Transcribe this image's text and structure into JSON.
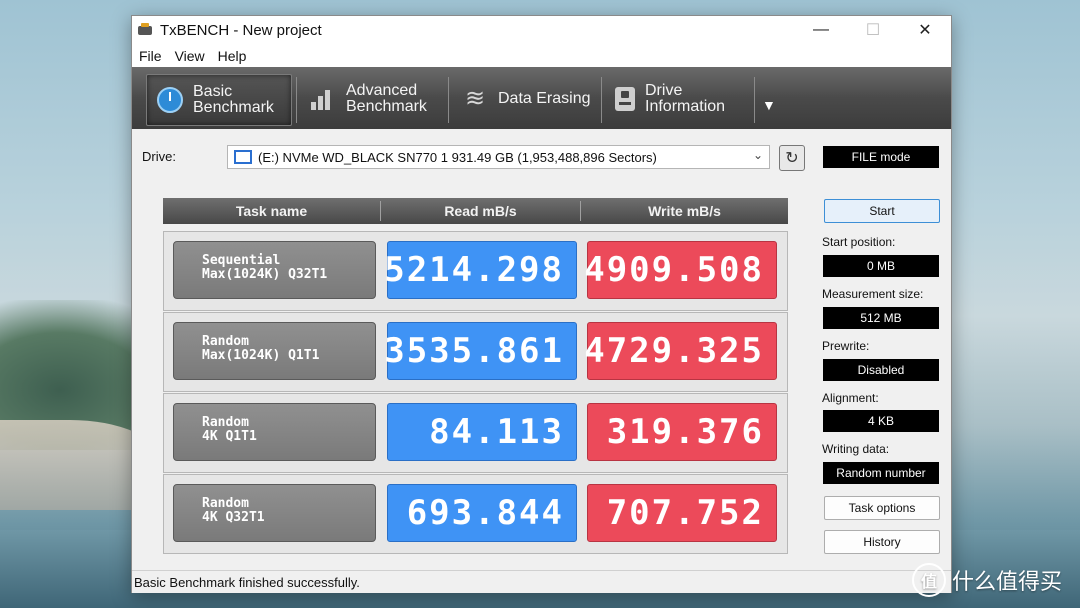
{
  "window": {
    "title": "TxBENCH - New project"
  },
  "window_controls": {
    "minimize": "—",
    "maximize": "☐",
    "close": "✕"
  },
  "menu": [
    "File",
    "View",
    "Help"
  ],
  "toolbar": {
    "tabs": [
      {
        "line1": "Basic",
        "line2": "Benchmark"
      },
      {
        "line1": "Advanced",
        "line2": "Benchmark"
      },
      {
        "line1": "Data Erasing",
        "line2": ""
      },
      {
        "line1": "Drive",
        "line2": "Information"
      }
    ],
    "more": "▼"
  },
  "drive": {
    "label": "Drive:",
    "value": "(E:) NVMe WD_BLACK SN770 1  931.49 GB (1,953,488,896 Sectors)",
    "mode": "FILE mode"
  },
  "grid": {
    "headers": {
      "task": "Task name",
      "read": "Read mB/s",
      "write": "Write mB/s"
    },
    "rows": [
      {
        "line1": "Sequential",
        "line2": "Max(1024K) Q32T1",
        "read": "5214.298",
        "write": "4909.508"
      },
      {
        "line1": "Random",
        "line2": "Max(1024K) Q1T1",
        "read": "3535.861",
        "write": "4729.325"
      },
      {
        "line1": "Random",
        "line2": "4K Q1T1",
        "read": "84.113",
        "write": "319.376"
      },
      {
        "line1": "Random",
        "line2": "4K Q32T1",
        "read": "693.844",
        "write": "707.752"
      }
    ]
  },
  "panel": {
    "start": "Start",
    "start_position": {
      "label": "Start position:",
      "value": "0 MB"
    },
    "measurement_size": {
      "label": "Measurement size:",
      "value": "512 MB"
    },
    "prewrite": {
      "label": "Prewrite:",
      "value": "Disabled"
    },
    "alignment": {
      "label": "Alignment:",
      "value": "4 KB"
    },
    "writing_data": {
      "label": "Writing data:",
      "value": "Random number"
    },
    "task_options": "Task options",
    "history": "History"
  },
  "status": "Basic Benchmark finished successfully.",
  "watermark": {
    "logo": "值",
    "text": "什么值得买"
  },
  "colors": {
    "read": "#3f93f5",
    "write": "#ec4a5a",
    "toolbar": "#4a4a4a"
  }
}
